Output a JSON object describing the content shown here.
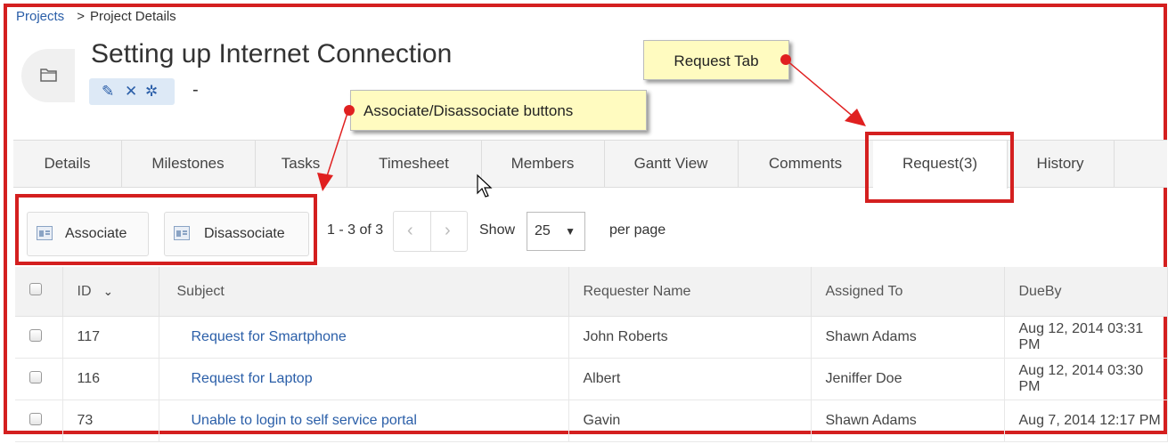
{
  "breadcrumb": {
    "projects": "Projects",
    "separator": ">",
    "current": "Project Details"
  },
  "project": {
    "title": "Setting up Internet Connection",
    "status": "-"
  },
  "icons": {
    "edit": "✎",
    "delete": "✕",
    "settings": "✲"
  },
  "callouts": {
    "request_tab": "Request Tab",
    "assoc_buttons": "Associate/Disassociate buttons"
  },
  "tabs": [
    "Details",
    "Milestones",
    "Tasks",
    "Timesheet",
    "Members",
    "Gantt View",
    "Comments",
    "Request(3)",
    "History"
  ],
  "active_tab": "Request(3)",
  "toolbar": {
    "associate": "Associate",
    "disassociate": "Disassociate"
  },
  "pagination": {
    "range": "1 - 3 of 3",
    "prev": "‹",
    "next": "›",
    "show": "Show",
    "per_page_value": "25",
    "per_page_label": "per page"
  },
  "table": {
    "headers": {
      "id": "ID",
      "sort_icon": "⌄",
      "subject": "Subject",
      "requester": "Requester Name",
      "assigned": "Assigned To",
      "dueby": "DueBy"
    },
    "rows": [
      {
        "id": "117",
        "subject": "Request for Smartphone",
        "requester": "John Roberts",
        "assigned": "Shawn Adams",
        "dueby": "Aug 12, 2014 03:31 PM"
      },
      {
        "id": "116",
        "subject": "Request for Laptop",
        "requester": "Albert",
        "assigned": "Jeniffer Doe",
        "dueby": "Aug 12, 2014 03:30 PM"
      },
      {
        "id": "73",
        "subject": "Unable to login to self service portal",
        "requester": "Gavin",
        "assigned": "Shawn Adams",
        "dueby": "Aug 7, 2014 12:17 PM"
      }
    ]
  },
  "colors": {
    "annotation_red": "#d41f1f",
    "link_blue": "#2a5ea8",
    "callout_yellow": "#fffbc0"
  }
}
